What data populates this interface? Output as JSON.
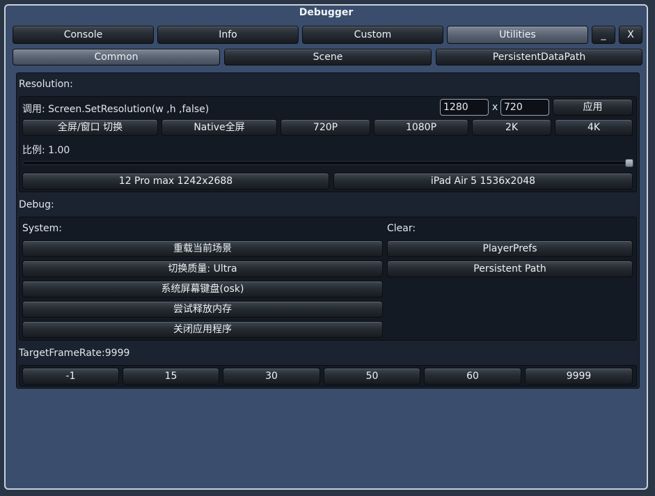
{
  "window": {
    "title": "Debugger"
  },
  "top_tabs": [
    {
      "label": "Console"
    },
    {
      "label": "Info"
    },
    {
      "label": "Custom"
    },
    {
      "label": "Utilities",
      "active": true
    }
  ],
  "window_controls": {
    "minimize": "_",
    "close": "X"
  },
  "sub_tabs": [
    {
      "label": "Common",
      "active": true
    },
    {
      "label": "Scene"
    },
    {
      "label": "PersistentDataPath"
    }
  ],
  "resolution": {
    "section_label": "Resolution:",
    "call_label": "调用: Screen.SetResolution(w ,h ,false)",
    "width_value": "1280",
    "x_label": "x",
    "height_value": "720",
    "apply_label": "应用",
    "presets": [
      "全屏/窗口 切换",
      "Native全屏",
      "720P",
      "1080P",
      "2K",
      "4K"
    ],
    "scale_label": "比例: 1.00",
    "scale_value": 1.0,
    "devices": [
      "12 Pro max 1242x2688",
      "iPad Air 5 1536x2048"
    ]
  },
  "debug": {
    "section_label": "Debug:",
    "system_label": "System:",
    "system_buttons": [
      "重载当前场景",
      "切换质量: Ultra",
      "系统屏幕键盘(osk)",
      "尝试释放内存",
      "关闭应用程序"
    ],
    "clear_label": "Clear:",
    "clear_buttons": [
      "PlayerPrefs",
      "Persistent Path"
    ]
  },
  "framerate": {
    "label": "TargetFrameRate:9999",
    "options": [
      "-1",
      "15",
      "30",
      "50",
      "60",
      "9999"
    ]
  },
  "colors": {
    "window_bg": "#3a4d6c",
    "panel_bg": "#1b2330",
    "active_tab": "#5a6473"
  }
}
